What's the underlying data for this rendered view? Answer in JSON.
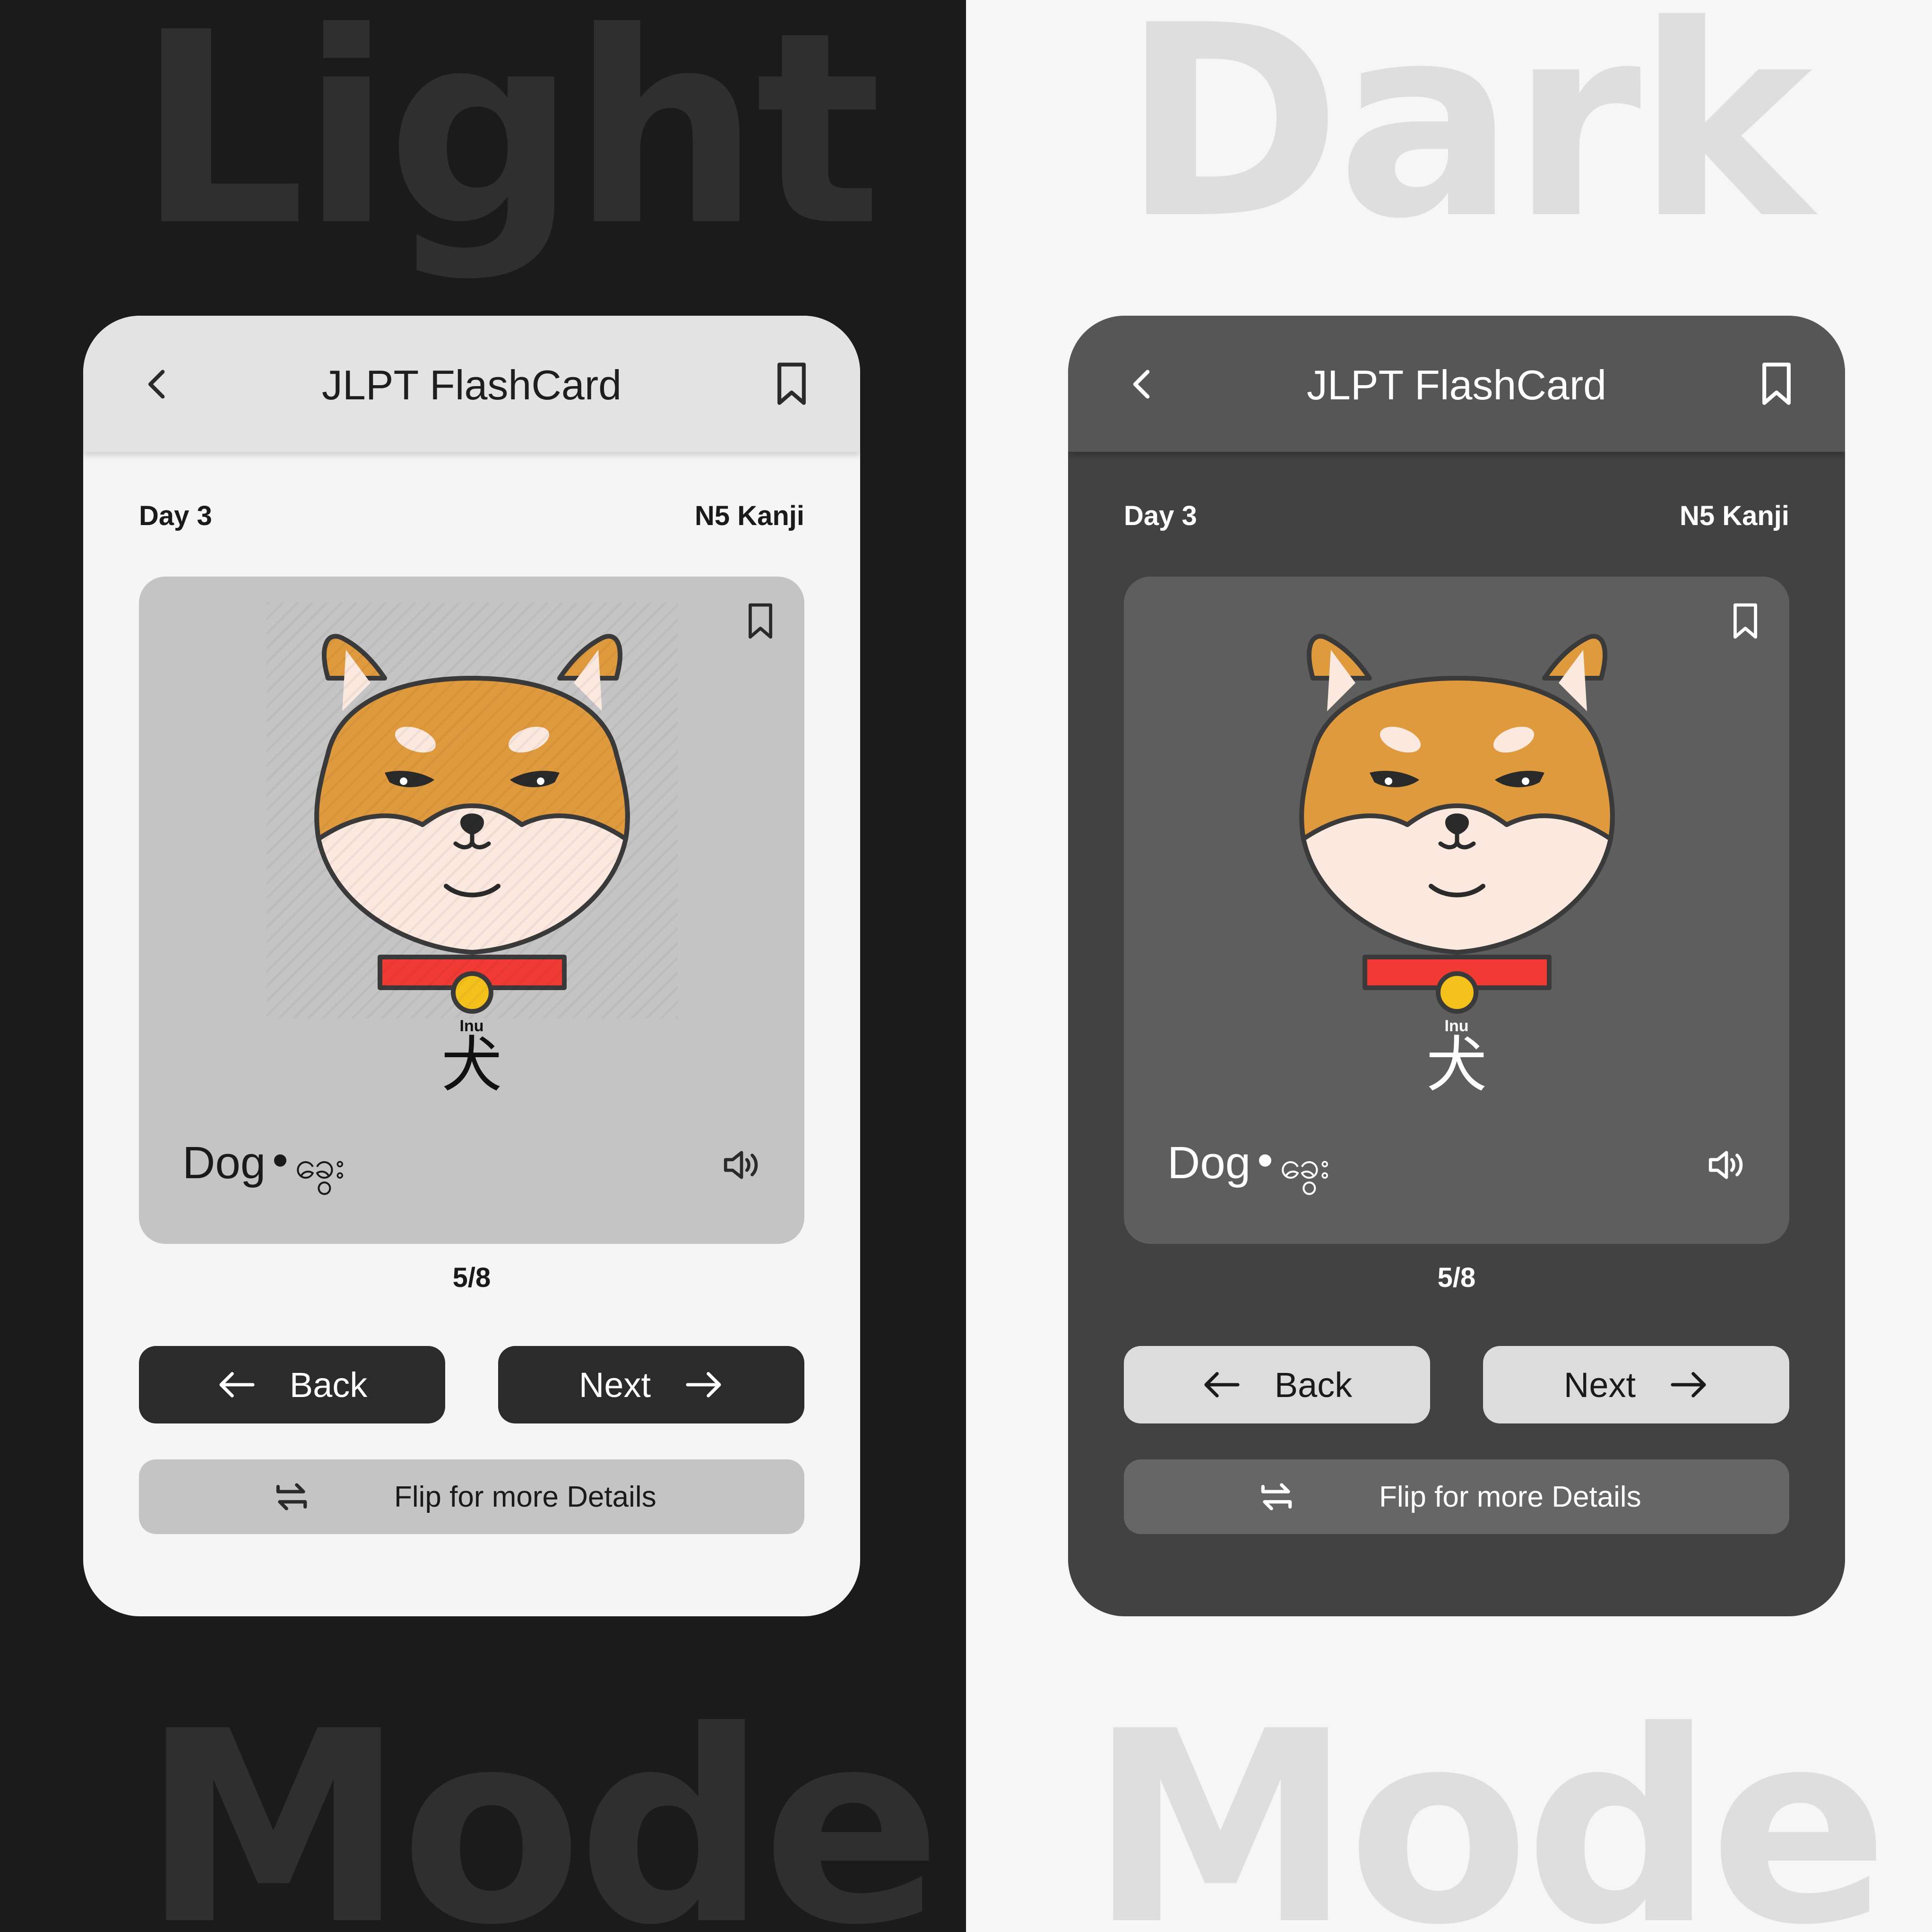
{
  "banner": {
    "left_top": "Light",
    "left_bottom": "Mode",
    "right_top": "Dark",
    "right_bottom": "Mode"
  },
  "app": {
    "title": "JLPT FlashCard",
    "day": "Day 3",
    "level": "N5 Kanji",
    "card": {
      "reading": "Inu",
      "kanji": "犬",
      "meaning": "Dog",
      "separator": "•",
      "translation": "ခွေး"
    },
    "progress": "5/8",
    "back_label": "Back",
    "next_label": "Next",
    "flip_label": "Flip for more Details"
  },
  "icons": [
    "chevron-left-icon",
    "bookmark-icon",
    "speaker-icon",
    "arrow-left-icon",
    "arrow-right-icon",
    "flip-icon"
  ],
  "colors": {
    "dog_orange": "#E09A3E",
    "dog_cream": "#FBE8DF",
    "collar_red": "#F23A35",
    "tag_yellow": "#F4C11C",
    "outline": "#3A3A3A"
  }
}
